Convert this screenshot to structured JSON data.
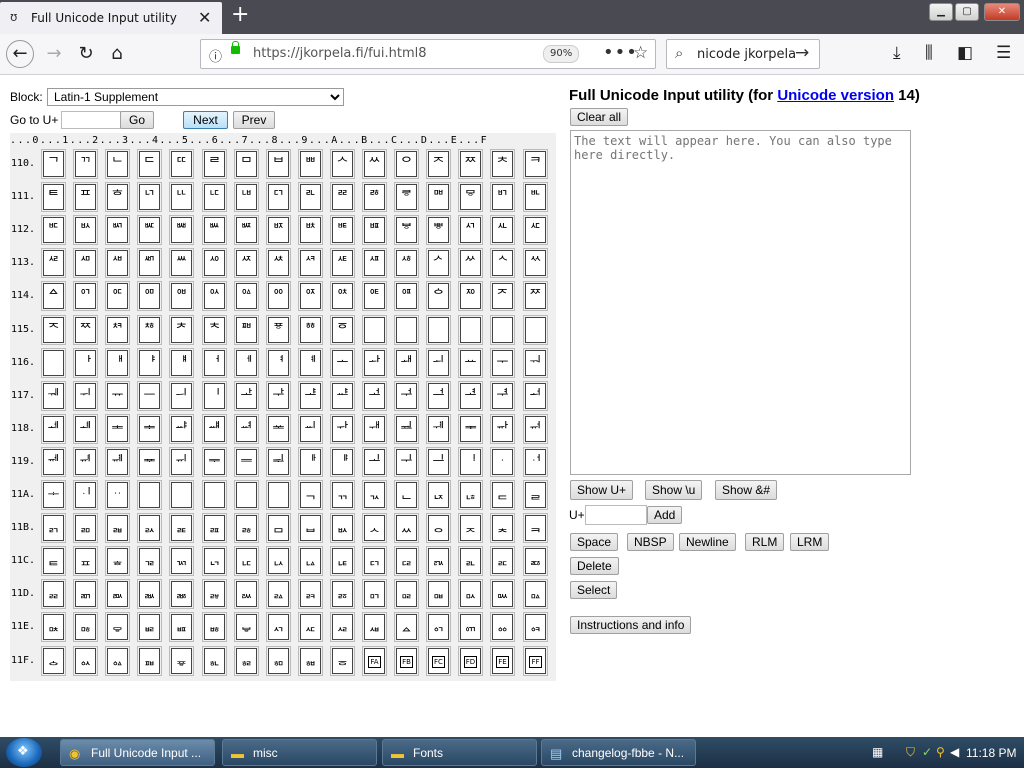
{
  "browser": {
    "tab_title": "Full Unicode Input utility",
    "tab_close": "✕",
    "new_tab": "+",
    "url": "https://jkorpela.fi/fui.html8",
    "zoom": "90%",
    "search_text": "nicode jkorpela",
    "accent": "#12bc00"
  },
  "page": {
    "block_label": "Block:",
    "block_value": "Latin-1 Supplement",
    "goto_label": "Go to U+",
    "go_button": "Go",
    "next_button": "Next",
    "prev_button": "Prev",
    "column_header": "...0...1...2...3...4...5...6...7...8...9...A...B...C...D...E...F",
    "rows": [
      {
        "label": "110.",
        "chars": [
          "ᄀ",
          "ᄁ",
          "ᄂ",
          "ᄃ",
          "ᄄ",
          "ᄅ",
          "ᄆ",
          "ᄇ",
          "ᄈ",
          "ᄉ",
          "ᄊ",
          "ᄋ",
          "ᄌ",
          "ᄍ",
          "ᄎ",
          "ᄏ"
        ]
      },
      {
        "label": "111.",
        "chars": [
          "ᄐ",
          "ᄑ",
          "ᄒ",
          "ᄓ",
          "ᄔ",
          "ᄕ",
          "ᄖ",
          "ᄗ",
          "ᄘ",
          "ᄙ",
          "ᄚ",
          "ᄛ",
          "ᄜ",
          "ᄝ",
          "ᄞ",
          "ᄟ"
        ]
      },
      {
        "label": "112.",
        "chars": [
          "ᄠ",
          "ᄡ",
          "ᄢ",
          "ᄣ",
          "ᄤ",
          "ᄥ",
          "ᄦ",
          "ᄧ",
          "ᄨ",
          "ᄩ",
          "ᄪ",
          "ᄫ",
          "ᄬ",
          "ᄭ",
          "ᄮ",
          "ᄯ"
        ]
      },
      {
        "label": "113.",
        "chars": [
          "ᄰ",
          "ᄱ",
          "ᄲ",
          "ᄳ",
          "ᄴ",
          "ᄵ",
          "ᄶ",
          "ᄷ",
          "ᄸ",
          "ᄹ",
          "ᄺ",
          "ᄻ",
          "ᄼ",
          "ᄽ",
          "ᄾ",
          "ᄿ"
        ]
      },
      {
        "label": "114.",
        "chars": [
          "ᅀ",
          "ᅁ",
          "ᅂ",
          "ᅃ",
          "ᅄ",
          "ᅅ",
          "ᅆ",
          "ᅇ",
          "ᅈ",
          "ᅉ",
          "ᅊ",
          "ᅋ",
          "ᅌ",
          "ᅍ",
          "ᅎ",
          "ᅏ"
        ]
      },
      {
        "label": "115.",
        "chars": [
          "ᅐ",
          "ᅑ",
          "ᅒ",
          "ᅓ",
          "ᅔ",
          "ᅕ",
          "ᅖ",
          "ᅗ",
          "ᅘ",
          "ᅙ",
          "",
          "",
          "",
          "",
          "",
          ""
        ]
      },
      {
        "label": "116.",
        "chars": [
          "",
          "ᅡ",
          "ᅢ",
          "ᅣ",
          "ᅤ",
          "ᅥ",
          "ᅦ",
          "ᅧ",
          "ᅨ",
          "ᅩ",
          "ᅪ",
          "ᅫ",
          "ᅬ",
          "ᅭ",
          "ᅮ",
          "ᅯ"
        ]
      },
      {
        "label": "117.",
        "chars": [
          "ᅰ",
          "ᅱ",
          "ᅲ",
          "ᅳ",
          "ᅴ",
          "ᅵ",
          "ᅶ",
          "ᅷ",
          "ᅸ",
          "ᅹ",
          "ᅺ",
          "ᅻ",
          "ᅼ",
          "ᅽ",
          "ᅾ",
          "ᅿ"
        ]
      },
      {
        "label": "118.",
        "chars": [
          "ᆀ",
          "ᆁ",
          "ᆂ",
          "ᆃ",
          "ᆄ",
          "ᆅ",
          "ᆆ",
          "ᆇ",
          "ᆈ",
          "ᆉ",
          "ᆊ",
          "ᆋ",
          "ᆌ",
          "ᆍ",
          "ᆎ",
          "ᆏ"
        ]
      },
      {
        "label": "119.",
        "chars": [
          "ᆐ",
          "ᆑ",
          "ᆒ",
          "ᆓ",
          "ᆔ",
          "ᆕ",
          "ᆖ",
          "ᆗ",
          "ᆘ",
          "ᆙ",
          "ᆚ",
          "ᆛ",
          "ᆜ",
          "ᆝ",
          "ᆞ",
          "ᆟ"
        ]
      },
      {
        "label": "11A.",
        "chars": [
          "ᆠ",
          "ᆡ",
          "ᆢ",
          "",
          "",
          "",
          "",
          "",
          "ᆨ",
          "ᆩ",
          "ᆪ",
          "ᆫ",
          "ᆬ",
          "ᆭ",
          "ᆮ",
          "ᆯ"
        ]
      },
      {
        "label": "11B.",
        "chars": [
          "ᆰ",
          "ᆱ",
          "ᆲ",
          "ᆳ",
          "ᆴ",
          "ᆵ",
          "ᆶ",
          "ᆷ",
          "ᆸ",
          "ᆹ",
          "ᆺ",
          "ᆻ",
          "ᆼ",
          "ᆽ",
          "ᆾ",
          "ᆿ"
        ]
      },
      {
        "label": "11C.",
        "chars": [
          "ᇀ",
          "ᇁ",
          "ᇂ",
          "ᇃ",
          "ᇄ",
          "ᇅ",
          "ᇆ",
          "ᇇ",
          "ᇈ",
          "ᇉ",
          "ᇊ",
          "ᇋ",
          "ᇌ",
          "ᇍ",
          "ᇎ",
          "ᇏ"
        ]
      },
      {
        "label": "11D.",
        "chars": [
          "ᇐ",
          "ᇑ",
          "ᇒ",
          "ᇓ",
          "ᇔ",
          "ᇕ",
          "ᇖ",
          "ᇗ",
          "ᇘ",
          "ᇙ",
          "ᇚ",
          "ᇛ",
          "ᇜ",
          "ᇝ",
          "ᇞ",
          "ᇟ"
        ]
      },
      {
        "label": "11E.",
        "chars": [
          "ᇠ",
          "ᇡ",
          "ᇢ",
          "ᇣ",
          "ᇤ",
          "ᇥ",
          "ᇦ",
          "ᇧ",
          "ᇨ",
          "ᇩ",
          "ᇪ",
          "ᇫ",
          "ᇬ",
          "ᇭ",
          "ᇮ",
          "ᇯ"
        ]
      },
      {
        "label": "11F.",
        "chars": [
          "ᇰ",
          "ᇱ",
          "ᇲ",
          "ᇳ",
          "ᇴ",
          "ᇵ",
          "ᇶ",
          "ᇷ",
          "ᇸ",
          "ᇹ",
          "",
          "",
          "",
          "",
          "",
          ""
        ]
      }
    ],
    "boxed_labels": {
      "115": [
        "",
        "",
        "",
        "",
        "",
        "",
        "",
        "",
        "",
        "",
        "",
        "",
        "",
        "",
        "",
        ""
      ],
      "11F": [
        "",
        "",
        "",
        "",
        "",
        "",
        "",
        "",
        "",
        "",
        "FA",
        "FB",
        "FC",
        "FD",
        "FE",
        "FF"
      ]
    },
    "right_title_prefix": "Full Unicode Input utility (for ",
    "right_title_link": "Unicode version",
    "right_title_suffix": " 14)",
    "clear_button": "Clear all",
    "textarea_placeholder": "The text will appear here. You can also type here directly.",
    "show_uplus": "Show U+",
    "show_u": "Show \\u",
    "show_amp": "Show &#",
    "uplus_label": "U+",
    "add_button": "Add",
    "space_button": "Space",
    "nbsp_button": "NBSP",
    "newline_button": "Newline",
    "rlm_button": "RLM",
    "lrm_button": "LRM",
    "delete_button": "Delete",
    "select_button": "Select",
    "instructions_button": "Instructions and info"
  },
  "taskbar": {
    "tasks": [
      {
        "label": "Full Unicode Input ...",
        "active": true
      },
      {
        "label": "misc",
        "active": false
      },
      {
        "label": "Fonts",
        "active": false
      },
      {
        "label": "changelog-fbbe - N...",
        "active": false
      }
    ],
    "clock": "11:18 PM"
  }
}
